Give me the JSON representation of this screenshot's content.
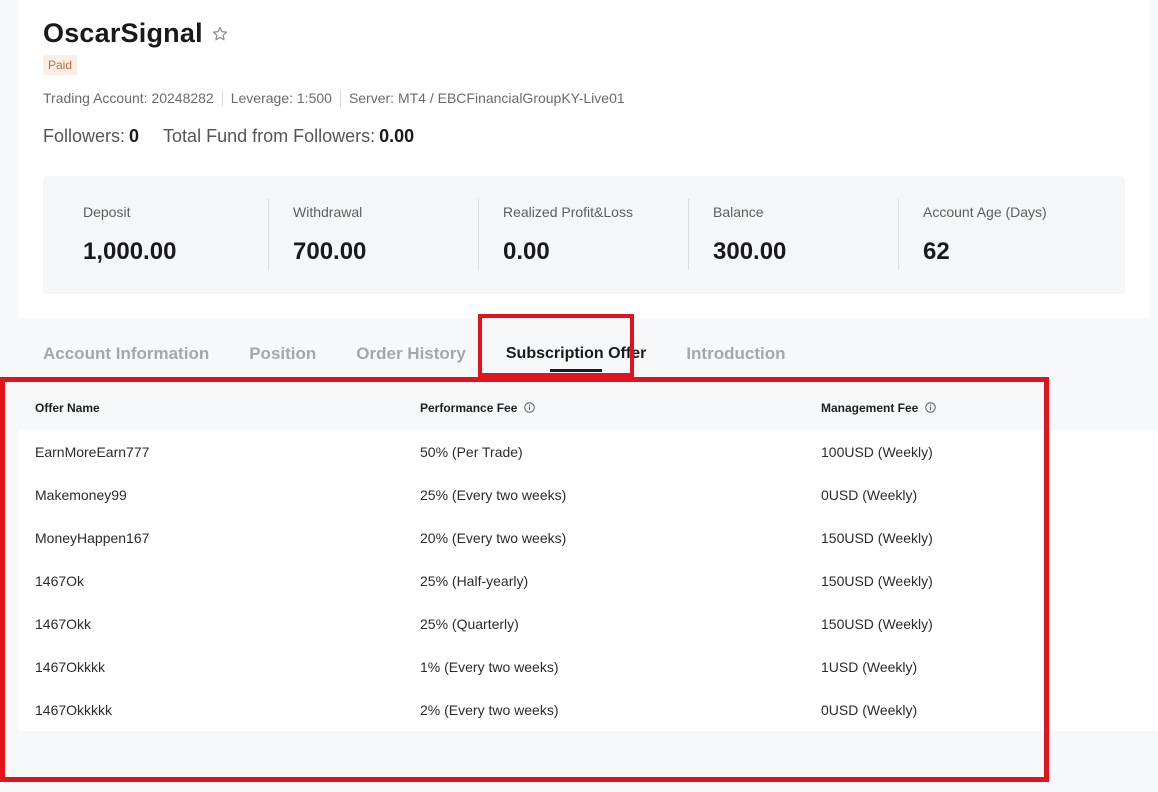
{
  "profile": {
    "title": "OscarSignal",
    "badge": "Paid",
    "meta": {
      "trading_account": "Trading Account: 20248282",
      "leverage": "Leverage: 1:500",
      "server": "Server: MT4 / EBCFinancialGroupKY-Live01"
    },
    "followers_label": "Followers:",
    "followers_value": "0",
    "total_fund_label": "Total Fund from Followers:",
    "total_fund_value": "0.00"
  },
  "stats": [
    {
      "label": "Deposit",
      "value": "1,000.00"
    },
    {
      "label": "Withdrawal",
      "value": "700.00"
    },
    {
      "label": "Realized Profit&Loss",
      "value": "0.00"
    },
    {
      "label": "Balance",
      "value": "300.00"
    },
    {
      "label": "Account Age (Days)",
      "value": "62"
    }
  ],
  "tabs": [
    {
      "label": "Account Information",
      "active": false
    },
    {
      "label": "Position",
      "active": false
    },
    {
      "label": "Order History",
      "active": false
    },
    {
      "label": "Subscription Offer",
      "active": true
    },
    {
      "label": "Introduction",
      "active": false
    }
  ],
  "table": {
    "headers": [
      "Offer Name",
      "Performance Fee",
      "Management Fee"
    ],
    "rows": [
      [
        "EarnMoreEarn777",
        "50% (Per Trade)",
        "100USD (Weekly)"
      ],
      [
        "Makemoney99",
        "25% (Every two weeks)",
        "0USD (Weekly)"
      ],
      [
        "MoneyHappen167",
        "20% (Every two weeks)",
        "150USD (Weekly)"
      ],
      [
        "1467Ok",
        "25% (Half-yearly)",
        "150USD (Weekly)"
      ],
      [
        "1467Okk",
        "25% (Quarterly)",
        "150USD (Weekly)"
      ],
      [
        "1467Okkkk",
        "1% (Every two weeks)",
        "1USD (Weekly)"
      ],
      [
        "1467Okkkkk",
        "2% (Every two weeks)",
        "0USD (Weekly)"
      ]
    ]
  },
  "colors": {
    "highlight": "#e0141c",
    "badge_bg": "#fbeee4",
    "badge_text": "#b5713f",
    "tab_inactive": "#a7a7a7"
  },
  "icons": {
    "favorite": "star-outline-icon",
    "fee_info": "info-circle-icon"
  }
}
